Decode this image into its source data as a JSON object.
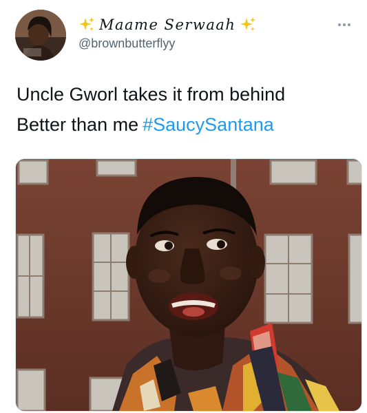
{
  "author": {
    "display_name": "Maame Serwaah",
    "handle": "@brownbutterflyy",
    "avatar_icon": "profile-photo"
  },
  "tweet": {
    "text_line1": "Uncle Gworl takes it from behind",
    "text_line2": "Better than me",
    "hashtag": "#SaucySantana"
  },
  "icons": {
    "sparkle": "sparkles-emoji-icon",
    "more": "more-options-icon"
  },
  "colors": {
    "hashtag": "#1d9bf0",
    "handle": "#536471",
    "sparkle": "#f5c518"
  }
}
